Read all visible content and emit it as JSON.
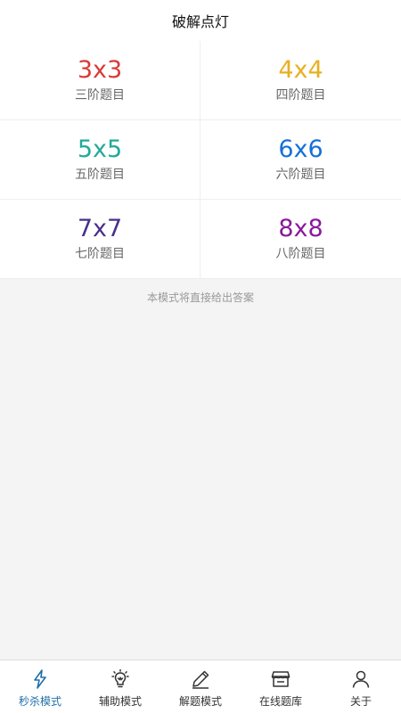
{
  "header": {
    "title": "破解点灯"
  },
  "puzzles": [
    {
      "size": "3x3",
      "label": "三阶题目",
      "color": "#d93a3a"
    },
    {
      "size": "4x4",
      "label": "四阶题目",
      "color": "#e8b020"
    },
    {
      "size": "5x5",
      "label": "五阶题目",
      "color": "#22aa99"
    },
    {
      "size": "6x6",
      "label": "六阶题目",
      "color": "#1570d8"
    },
    {
      "size": "7x7",
      "label": "七阶题目",
      "color": "#4a2f8a"
    },
    {
      "size": "8x8",
      "label": "八阶题目",
      "color": "#8a1a9a"
    }
  ],
  "hint": "本模式将直接给出答案",
  "tabs": [
    {
      "label": "秒杀模式",
      "icon": "lightning-icon",
      "active": true
    },
    {
      "label": "辅助模式",
      "icon": "lightbulb-icon",
      "active": false
    },
    {
      "label": "解题模式",
      "icon": "pencil-icon",
      "active": false
    },
    {
      "label": "在线题库",
      "icon": "storefront-icon",
      "active": false
    },
    {
      "label": "关于",
      "icon": "person-icon",
      "active": false
    }
  ],
  "colors": {
    "active_tab": "#1f6fa8",
    "inactive_tab": "#333333"
  }
}
